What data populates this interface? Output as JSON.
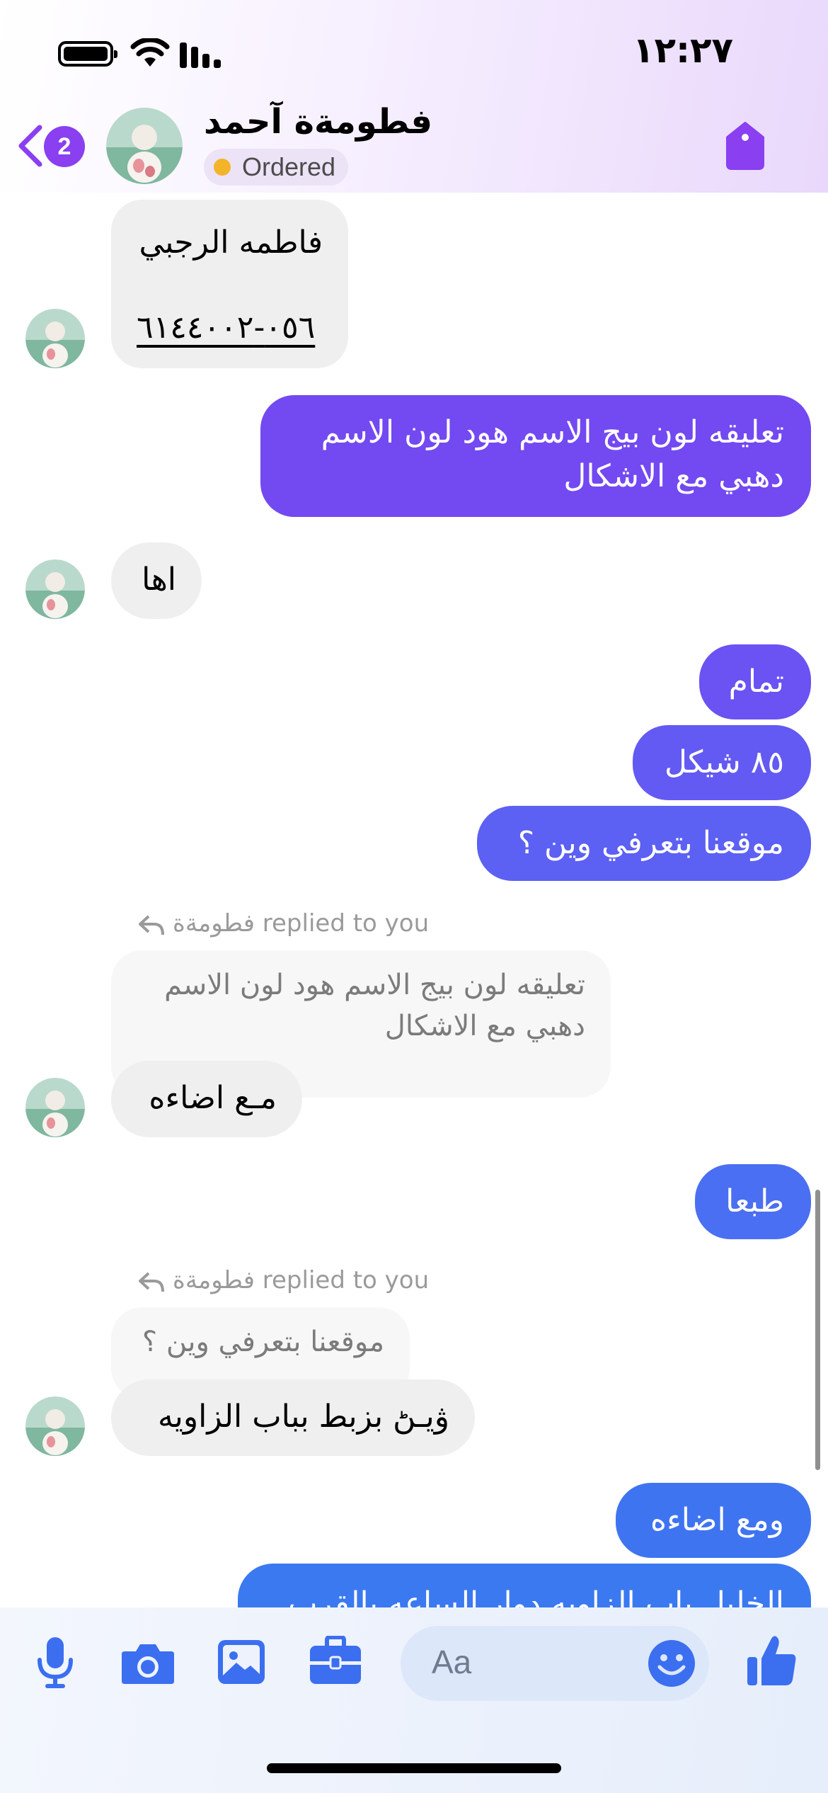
{
  "status_bar": {
    "time": "١٢:٢٧"
  },
  "header": {
    "unread_count": "2",
    "contact_name": "فطومةة آحمد",
    "status_label": "Ordered",
    "status_color": "#f4b42a",
    "accent_color": "#8a3ff0",
    "icons": [
      "chevron-left-icon",
      "avatar",
      "tag-icon"
    ]
  },
  "messages": [
    {
      "from": "them",
      "line1": "فاطمه الرجبي",
      "phone": "٠٥٦-٦١٤٤٠٠٢"
    },
    {
      "from": "me",
      "line1": "تعليقه لون بيج الاسم هود لون الاسم",
      "line2": "دهبي مع الاشكال"
    },
    {
      "from": "them",
      "text": "اها"
    },
    {
      "from": "me",
      "text": "تمام"
    },
    {
      "from": "me",
      "text": "٨٥ شيكل"
    },
    {
      "from": "me",
      "text": "موقعنا بتعرفي وين ؟"
    },
    {
      "from": "them",
      "reply_label": "فطومةة replied to you",
      "quoted_line1": "تعليقه لون بيج الاسم هود لون الاسم",
      "quoted_line2": "دهبي مع الاشكال",
      "text": "مـع اضاءه"
    },
    {
      "from": "me",
      "text": "طبعا"
    },
    {
      "from": "them",
      "reply_label": "فطومةة replied to you",
      "quoted_line1": "موقعنا بتعرفي وين ؟",
      "text": "ۋيـڻ بزبط بباب الزاويه"
    },
    {
      "from": "me",
      "text": "ومع اضاءه"
    },
    {
      "from": "me",
      "text": "الخليل باب الزاويه دوار الساعه بالقرب"
    }
  ],
  "composer": {
    "placeholder": "Aa",
    "accent_color": "#3b6ff0",
    "icons": [
      "microphone-icon",
      "camera-icon",
      "gallery-icon",
      "briefcase-icon",
      "emoji-icon",
      "thumbs-up-icon"
    ]
  }
}
